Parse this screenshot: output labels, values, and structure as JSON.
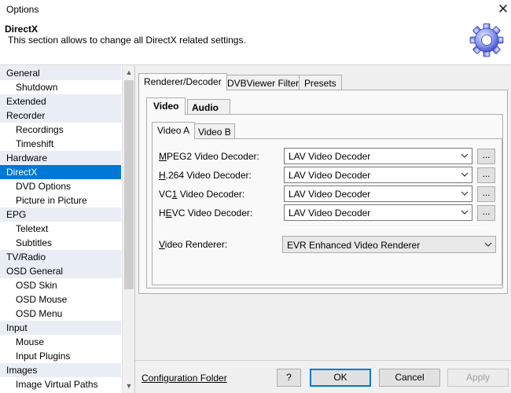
{
  "window": {
    "title": "Options"
  },
  "header": {
    "title": "DirectX",
    "description": "This section allows to change all DirectX related settings."
  },
  "sidebar": {
    "items": [
      {
        "label": "General",
        "level": 0
      },
      {
        "label": "Shutdown",
        "level": 1
      },
      {
        "label": "Extended",
        "level": 0
      },
      {
        "label": "Recorder",
        "level": 0
      },
      {
        "label": "Recordings",
        "level": 1
      },
      {
        "label": "Timeshift",
        "level": 1
      },
      {
        "label": "Hardware",
        "level": 0
      },
      {
        "label": "DirectX",
        "level": 0,
        "selected": true
      },
      {
        "label": "DVD Options",
        "level": 1
      },
      {
        "label": "Picture in Picture",
        "level": 1
      },
      {
        "label": "EPG",
        "level": 0
      },
      {
        "label": "Teletext",
        "level": 1
      },
      {
        "label": "Subtitles",
        "level": 1
      },
      {
        "label": "TV/Radio",
        "level": 0
      },
      {
        "label": "OSD General",
        "level": 0
      },
      {
        "label": "OSD Skin",
        "level": 1
      },
      {
        "label": "OSD Mouse",
        "level": 1
      },
      {
        "label": "OSD Menu",
        "level": 1
      },
      {
        "label": "Input",
        "level": 0
      },
      {
        "label": "Mouse",
        "level": 1
      },
      {
        "label": "Input Plugins",
        "level": 1
      },
      {
        "label": "Images",
        "level": 0
      },
      {
        "label": "Image Virtual Paths",
        "level": 1
      }
    ]
  },
  "tabs": {
    "main": [
      "Renderer/Decoder",
      "DVBViewer Filter",
      "Presets"
    ],
    "media": [
      "Video",
      "Audio"
    ],
    "sub": [
      "Video A",
      "Video B"
    ]
  },
  "decoders": [
    {
      "label": "MPEG2 Video Decoder:",
      "accel": "M",
      "rest": "PEG2 Video Decoder:",
      "value": "LAV Video Decoder"
    },
    {
      "label": "H.264 Video Decoder:",
      "accel": "H",
      "rest": ".264 Video Decoder:",
      "value": "LAV Video Decoder"
    },
    {
      "label": "VC1 Video Decoder:",
      "pre": "VC",
      "accel": "1",
      "rest": " Video Decoder:",
      "value": "LAV Video Decoder"
    },
    {
      "label": "HEVC Video Decoder:",
      "pre": "H",
      "accel": "E",
      "rest": "VC Video Decoder:",
      "value": "LAV Video Decoder"
    }
  ],
  "settings_button_label": "...",
  "renderer": {
    "label": "Video Renderer:",
    "accel": "V",
    "rest": "ideo Renderer:",
    "value": "EVR Enhanced Video Renderer"
  },
  "footer": {
    "config_link": "Configuration Folder",
    "help": "?",
    "ok": "OK",
    "cancel": "Cancel",
    "apply": "Apply"
  },
  "colors": {
    "selection": "#0078d7",
    "category_bg": "#e9eef6"
  }
}
